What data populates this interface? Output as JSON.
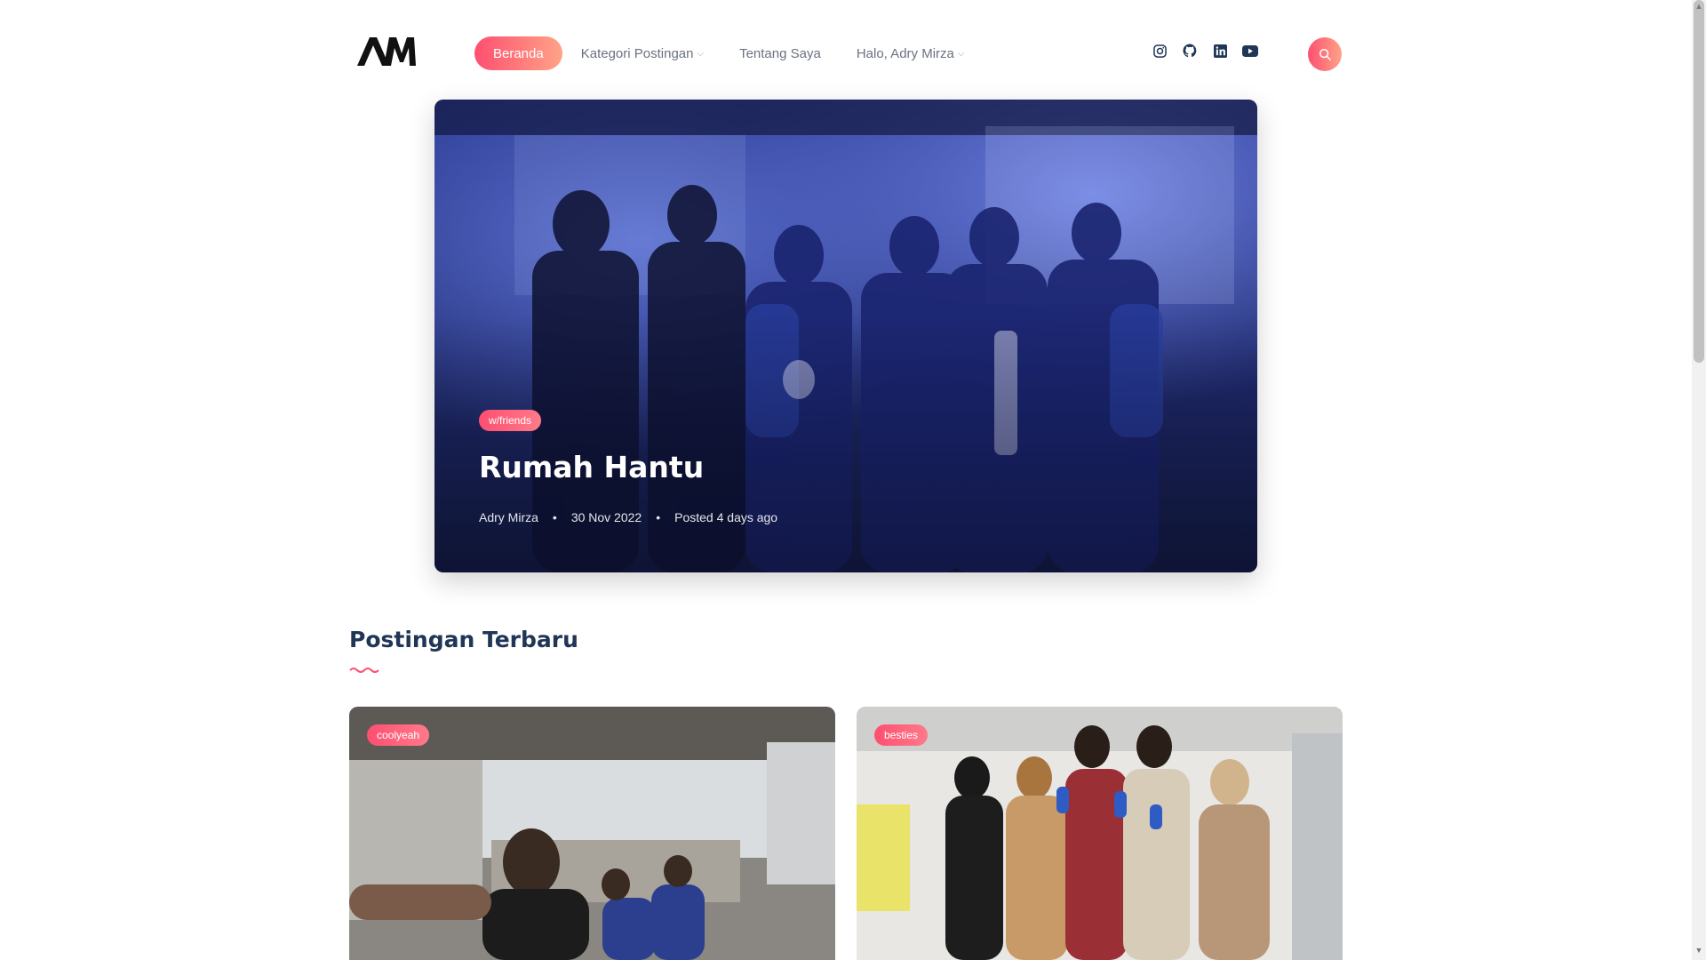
{
  "nav": {
    "items": [
      "Beranda",
      "Kategori Postingan",
      "Tentang Saya",
      "Halo, Adry Mirza"
    ]
  },
  "socials": [
    "instagram-icon",
    "github-icon",
    "linkedin-icon",
    "youtube-icon"
  ],
  "colors": {
    "accent_start": "#fe4f70",
    "accent_end": "#ffa387",
    "heading": "#203656"
  },
  "hero": {
    "category": "w/friends",
    "title": "Rumah Hantu",
    "author": "Adry Mirza",
    "date": "30 Nov 2022",
    "posted": "Posted 4 days ago"
  },
  "section": {
    "title": "Postingan Terbaru"
  },
  "cards": [
    {
      "category": "coolyeah"
    },
    {
      "category": "besties"
    }
  ]
}
